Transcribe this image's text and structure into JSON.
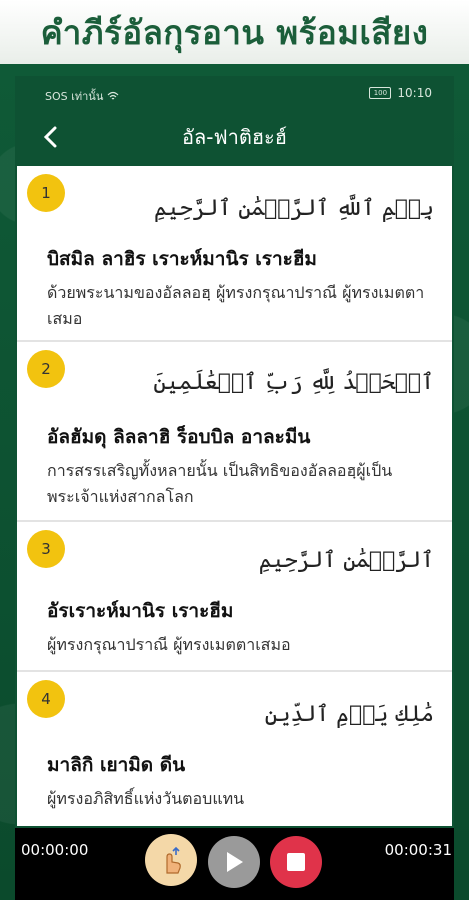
{
  "banner": {
    "text": "คำภีร์อัลกุรอาน พร้อมเสียง"
  },
  "statusbar": {
    "carrier": "SOS เท่านั้น",
    "battery": "100",
    "time": "10:10"
  },
  "appbar": {
    "title": "อัล-ฟาติฮะฮ์"
  },
  "verses": [
    {
      "number": "1",
      "arabic": "بِسۡمِ ٱللَّهِ ٱلرَّحۡمَٰنِ ٱلرَّحِيمِ",
      "transliteration": "บิสมิล ลาฮิร เราะห์มานิร เราะฮีม",
      "translation": "ด้วยพระนามของอัลลอฮฺ ผู้ทรงกรุณาปราณี ผู้ทรงเมตตาเสมอ"
    },
    {
      "number": "2",
      "arabic": "ٱلۡحَمۡدُ لِلَّهِ رَبِّ ٱلۡعَٰلَمِينَ",
      "transliteration": "อัลฮัมดุ ลิลลาฮิ ร็อบบิล อาละมีน",
      "translation": "การสรรเสริญทั้งหลายนั้น เป็นสิทธิของอัลลอฮฺผู้เป็นพระเจ้าแห่งสากลโลก"
    },
    {
      "number": "3",
      "arabic": "ٱلرَّحۡمَٰنِ ٱلرَّحِيمِ",
      "transliteration": "อัรเราะห์มานิร เราะฮีม",
      "translation": "ผู้ทรงกรุณาปราณี ผู้ทรงเมตตาเสมอ"
    },
    {
      "number": "4",
      "arabic": "مَٰلِكِ يَوۡمِ ٱلدِّينِ",
      "transliteration": "มาลิกิ เยามิด ดีน",
      "translation": "ผู้ทรงอภิสิทธิ์แห่งวันตอบแทน"
    }
  ],
  "player": {
    "elapsed": "00:00:00",
    "duration": "00:00:31"
  },
  "colors": {
    "accent": "#f2c30f",
    "background": "#0e5233",
    "stop": "#e0334a"
  }
}
